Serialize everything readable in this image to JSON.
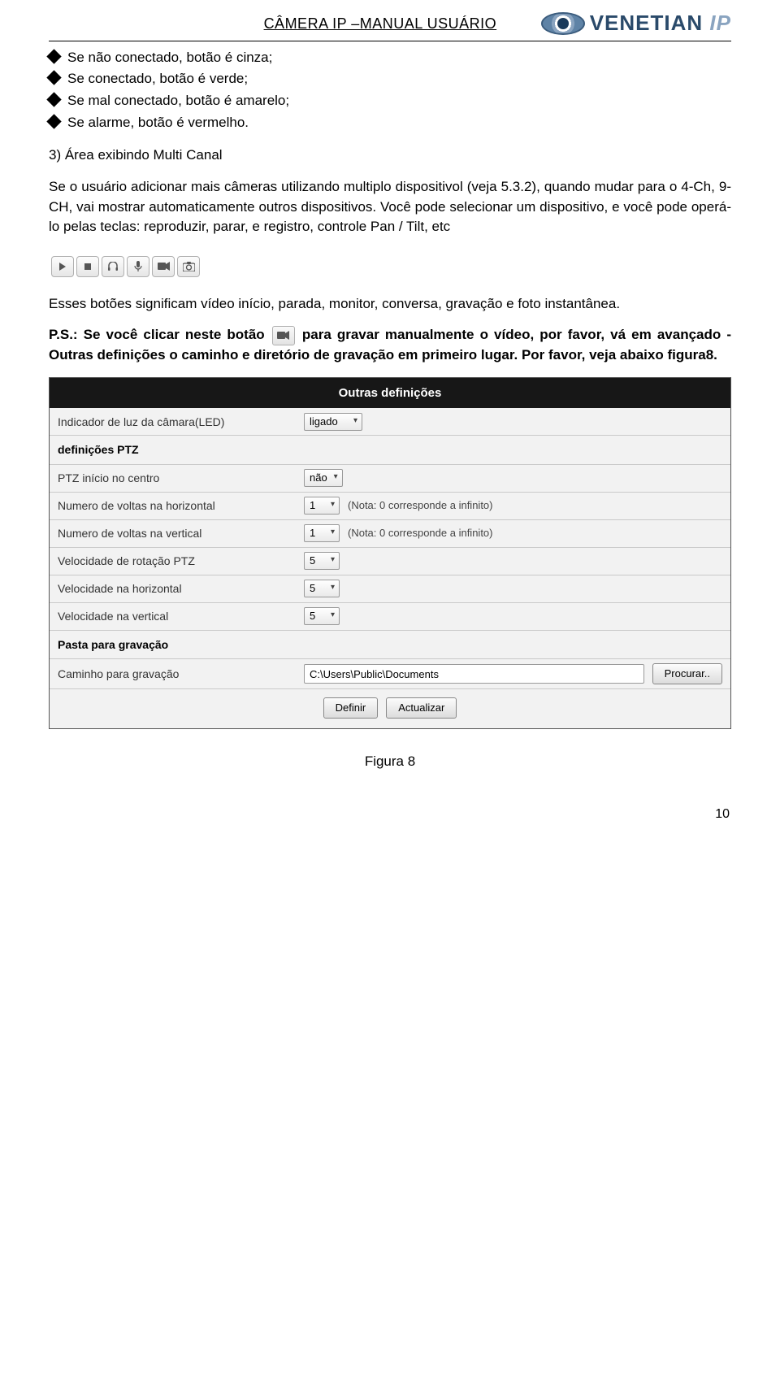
{
  "header": {
    "title": "CÂMERA  IP  –MANUAL  USUÁRIO",
    "logo_text": "VENETIAN",
    "logo_suffix": "IP"
  },
  "bullets": [
    "Se não conectado, botão é cinza;",
    "Se conectado, botão é verde;",
    "Se mal conectado, botão é amarelo;",
    "Se alarme, botão é vermelho."
  ],
  "para1": "3) Área exibindo Multi Canal",
  "para2": "Se o usuário adicionar mais câmeras utilizando multiplo dispositivol (veja 5.3.2), quando mudar para o 4-Ch, 9-CH, vai mostrar automaticamente outros dispositivos. Você pode selecionar um dispositivo, e você pode operá-lo pelas teclas: reproduzir, parar, e registro, controle Pan / Tilt, etc",
  "para3": "Esses botões significam vídeo início, parada, monitor, conversa, gravação e foto instantânea.",
  "ps_prefix": "P.S.: Se você clicar neste botão ",
  "ps_suffix": "para gravar manualmente o vídeo, por favor, vá em avançado - Outras definições o caminho e diretório de gravação em primeiro lugar. Por favor, veja abaixo figura8.",
  "icons": [
    "play-icon",
    "stop-icon",
    "headphones-icon",
    "mic-icon",
    "camera-icon",
    "snapshot-icon"
  ],
  "panel": {
    "title": "Outras definições",
    "rows": [
      {
        "label": "Indicador de luz da câmara(LED)",
        "value": "ligado",
        "select_wide": true
      },
      {
        "section": "definições PTZ"
      },
      {
        "label": "PTZ início no centro",
        "value": "não"
      },
      {
        "label": "Numero de voltas na horizontal",
        "value": "1",
        "note": "(Nota: 0 corresponde a infinito)"
      },
      {
        "label": "Numero de voltas na vertical",
        "value": "1",
        "note": "(Nota: 0 corresponde a infinito)"
      },
      {
        "label": "Velocidade de rotação PTZ",
        "value": "5"
      },
      {
        "label": "Velocidade na horizontal",
        "value": "5"
      },
      {
        "label": "Velocidade na vertical",
        "value": "5"
      },
      {
        "section": "Pasta para gravação"
      },
      {
        "label": "Caminho para gravação",
        "path": "C:\\Users\\Public\\Documents",
        "browse": "Procurar.."
      }
    ],
    "buttons": {
      "apply": "Definir",
      "refresh": "Actualizar"
    }
  },
  "caption": "Figura 8",
  "page_number": "10"
}
